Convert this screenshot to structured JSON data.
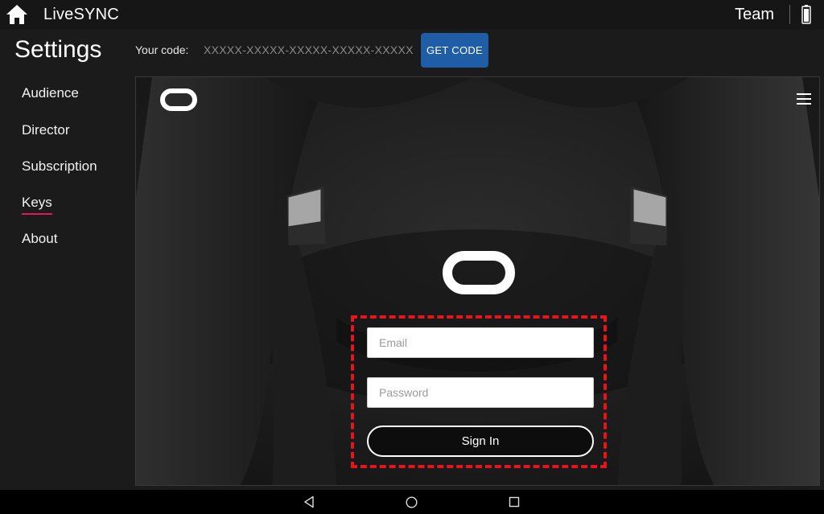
{
  "header": {
    "app_title": "LiveSYNC",
    "team_label": "Team",
    "home_icon": "home-icon",
    "battery_icon": "battery-icon"
  },
  "settings": {
    "title": "Settings",
    "code_label": "Your code:",
    "code_value": "XXXXX-XXXXX-XXXXX-XXXXX-XXXXX",
    "get_code_label": "GET CODE",
    "button_color": "#1f5ea6"
  },
  "sidebar": {
    "items": [
      {
        "label": "Audience"
      },
      {
        "label": "Director"
      },
      {
        "label": "Subscription"
      },
      {
        "label": "Keys",
        "active": true
      },
      {
        "label": "About"
      }
    ],
    "active_color": "#e3175e"
  },
  "login": {
    "email_placeholder": "Email",
    "password_placeholder": "Password",
    "sign_in_label": "Sign In",
    "highlight_color": "#e3151d",
    "logo": "oculus-logo-icon",
    "menu_icon": "hamburger-menu-icon"
  },
  "android_nav": {
    "back_icon": "back-triangle-icon",
    "home_icon": "home-circle-icon",
    "recents_icon": "recents-square-icon"
  }
}
